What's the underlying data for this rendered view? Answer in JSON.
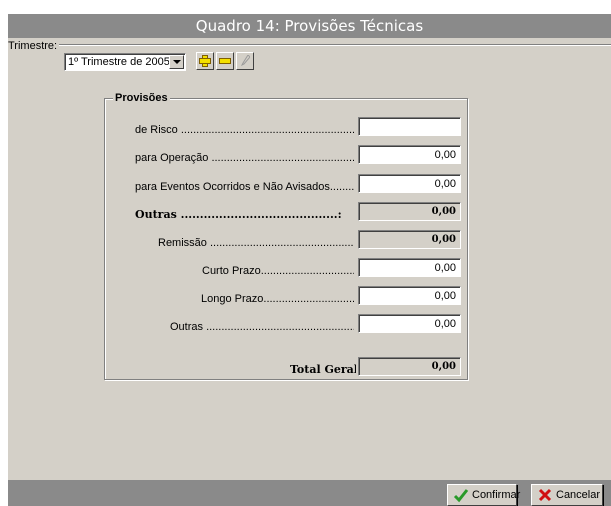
{
  "window": {
    "title": "Quadro 14: Provisões Técnicas"
  },
  "toolbar": {
    "trimestre_label": "Trimestre:",
    "trimestre_value": "1º Trimestre de 2005",
    "add_icon": "plus-icon",
    "remove_icon": "minus-icon",
    "edit_icon": "pencil-icon"
  },
  "group": {
    "title": "Provisões",
    "rows": [
      {
        "label": "de Risco",
        "value": ""
      },
      {
        "label": "para Operação",
        "value": "0,00"
      },
      {
        "label": "para Eventos Ocorridos e Não Avisados",
        "value": "0,00"
      },
      {
        "label": "Outras",
        "value": "0,00"
      },
      {
        "label": "Remissão",
        "value": "0,00"
      },
      {
        "label": "Curto Prazo",
        "value": "0,00"
      },
      {
        "label": "Longo Prazo",
        "value": "0,00"
      },
      {
        "label": "Outras",
        "value": "0,00"
      }
    ],
    "total_label": "Total Geral:",
    "total_value": "0,00"
  },
  "buttons": {
    "confirm": "Confirmar",
    "cancel": "Cancelar"
  },
  "colors": {
    "title_bar": "#8a8a8a",
    "window_bg": "#d4d0c8",
    "confirm_icon": "#2a9a2a",
    "cancel_icon": "#d01010"
  }
}
